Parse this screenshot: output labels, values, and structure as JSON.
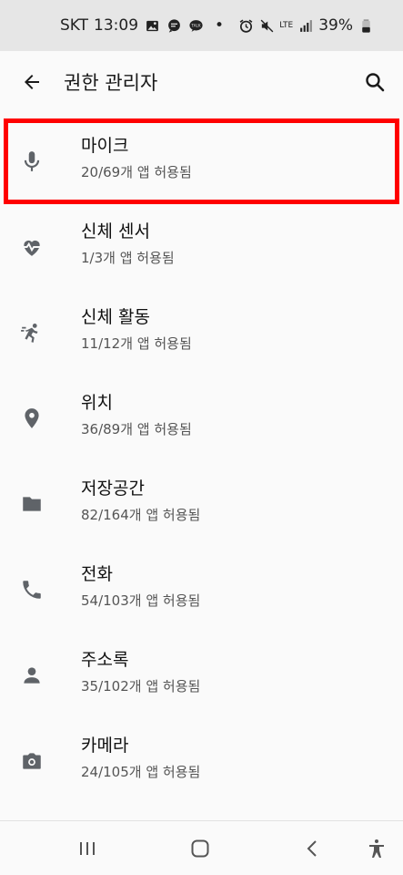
{
  "status_bar": {
    "carrier": "SKT",
    "time": "13:09",
    "dot": "•",
    "network": "LTE",
    "battery": "39%"
  },
  "app_bar": {
    "title": "권한 관리자"
  },
  "permissions": [
    {
      "name": "마이크",
      "count": "20/69개 앱 허용됨",
      "icon": "microphone-icon"
    },
    {
      "name": "신체 센서",
      "count": "1/3개 앱 허용됨",
      "icon": "heart-rate-icon"
    },
    {
      "name": "신체 활동",
      "count": "11/12개 앱 허용됨",
      "icon": "running-icon"
    },
    {
      "name": "위치",
      "count": "36/89개 앱 허용됨",
      "icon": "location-pin-icon"
    },
    {
      "name": "저장공간",
      "count": "82/164개 앱 허용됨",
      "icon": "folder-icon"
    },
    {
      "name": "전화",
      "count": "54/103개 앱 허용됨",
      "icon": "phone-icon"
    },
    {
      "name": "주소록",
      "count": "35/102개 앱 허용됨",
      "icon": "person-icon"
    },
    {
      "name": "카메라",
      "count": "24/105개 앱 허용됨",
      "icon": "camera-icon"
    }
  ],
  "colors": {
    "highlight": "#ff0000",
    "icon": "#5f6368",
    "status_bar_bg": "#e6e6e6"
  }
}
